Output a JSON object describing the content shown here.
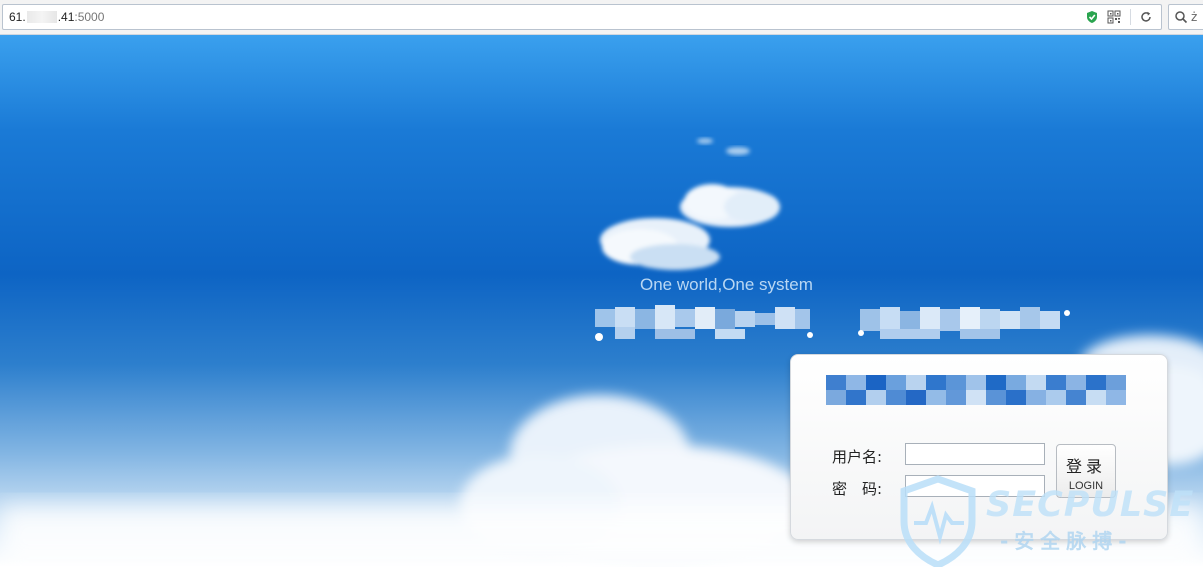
{
  "browser": {
    "url_prefix": "61.",
    "url_suffix": ".41",
    "url_port": ":5000",
    "search_text": "ż"
  },
  "page": {
    "slogan": "One world,One system"
  },
  "login": {
    "username_label": "用户名:",
    "password_label": "密　码:",
    "username_value": "",
    "password_value": "",
    "button_cn": "登录",
    "button_en": "LOGIN"
  },
  "watermark": {
    "brand": "SECPULSE",
    "sub": "-安全脉搏-"
  },
  "colors": {
    "sky_top": "#3aa0ee",
    "sky_mid": "#0d64c4",
    "shield_green": "#2aa44f",
    "watermark": "#bfe0f8"
  }
}
